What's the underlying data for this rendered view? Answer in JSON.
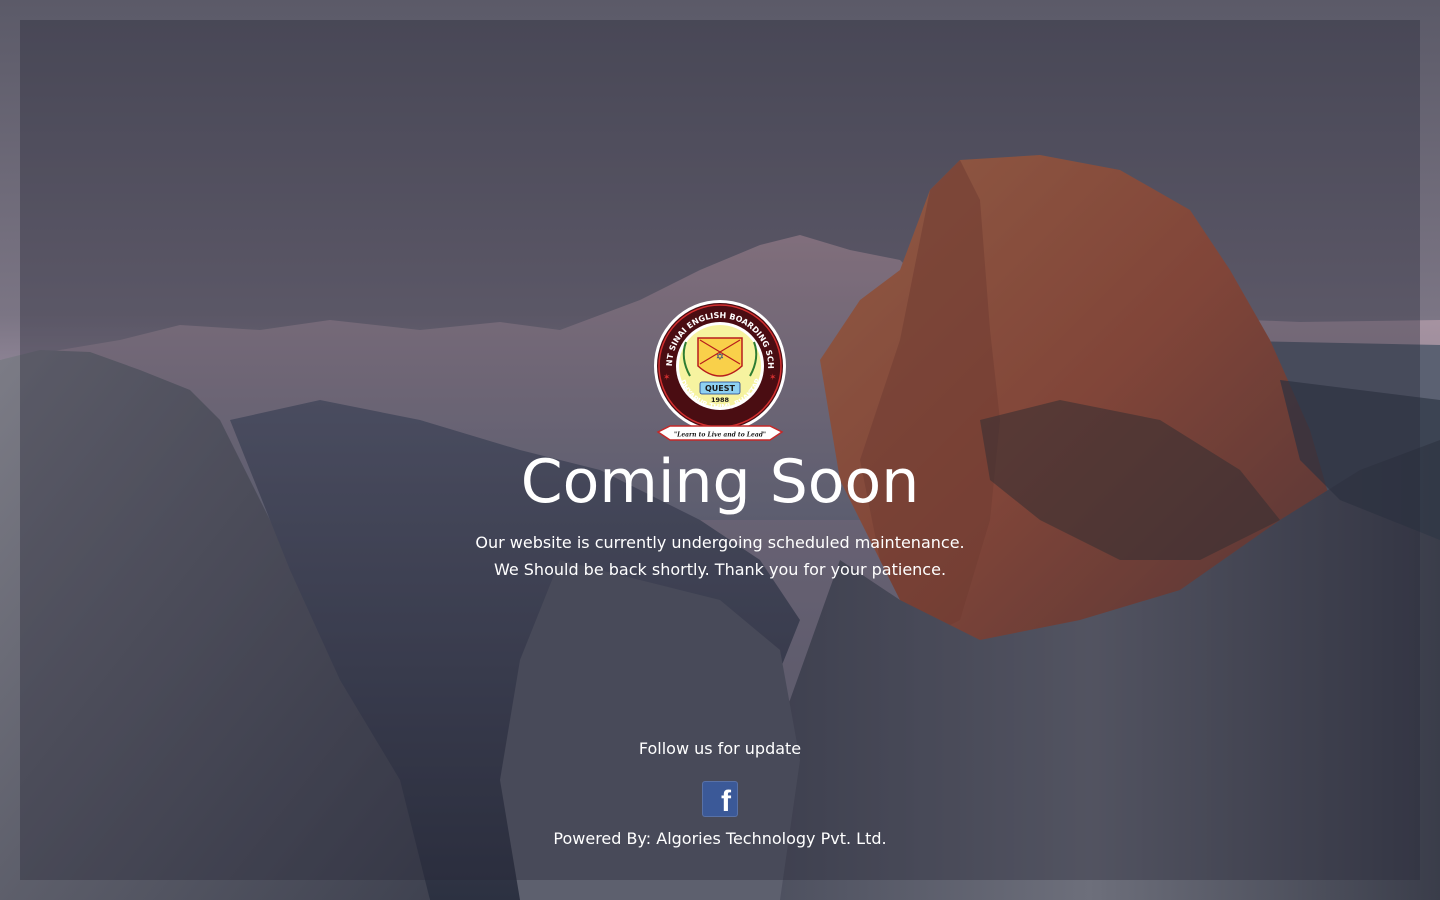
{
  "page": {
    "title": "Coming Soon",
    "message_line_1": "Our website is currently undergoing scheduled maintenance.",
    "message_line_2": "We Should be back shortly. Thank you for your patience.",
    "follow_text": "Follow us for update",
    "powered_by": "Powered By: Algories Technology Pvt. Ltd."
  },
  "logo": {
    "school_name": "MOUNT SINAI ENGLISH BOARDING SCHOOL",
    "location": "MADHYAPUR THIMI, BHAKTAPUR",
    "emblem_text": "QUEST",
    "year": "1988",
    "motto": "\"Learn to Live and to Lead\""
  },
  "social": {
    "facebook_label": "f",
    "facebook_icon": "facebook-icon"
  },
  "colors": {
    "overlay": "#28283a",
    "facebook": "#3b5998",
    "text": "#ffffff",
    "logo_red": "#c62828",
    "logo_yellow": "#f6f3a0"
  }
}
